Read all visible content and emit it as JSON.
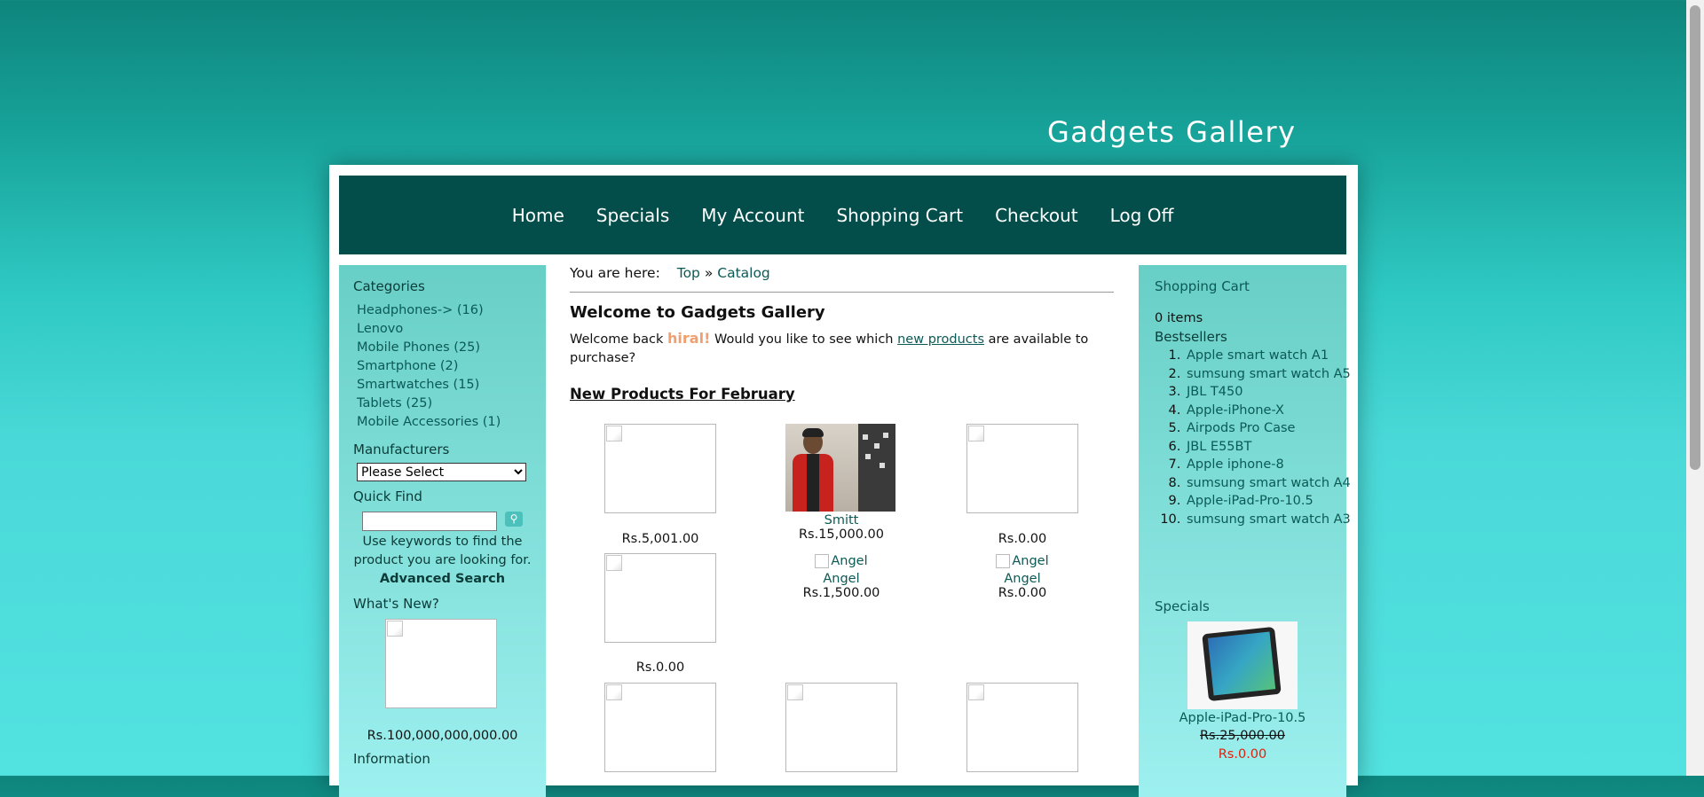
{
  "site": {
    "title": "Gadgets Gallery"
  },
  "nav": [
    "Home",
    "Specials",
    "My Account",
    "Shopping Cart",
    "Checkout",
    "Log Off"
  ],
  "left": {
    "categories_title": "Categories",
    "categories": [
      "Headphones-> (16)",
      "Lenovo",
      "Mobile Phones (25)",
      "Smartphone (2)",
      "Smartwatches (15)",
      "Tablets (25)",
      "Mobile Accessories (1)"
    ],
    "manufacturers_title": "Manufacturers",
    "manufacturers_selected": "Please Select",
    "quickfind_title": "Quick Find",
    "quickfind_help": "Use keywords to find the product you are looking for.",
    "advanced_search": "Advanced Search",
    "whatsnew_title": "What's New?",
    "whatsnew_price": "Rs.100,000,000,000.00",
    "information_title": "Information"
  },
  "center": {
    "breadcrumb_label": "You are here:",
    "breadcrumb_top": "Top",
    "breadcrumb_sep": "»",
    "breadcrumb_catalog": "Catalog",
    "heading": "Welcome to Gadgets Gallery",
    "greet_before": "Welcome back",
    "greet_user": "hiral!",
    "greet_mid": "Would you like to see which",
    "greet_link": "new products",
    "greet_after": "are available to purchase?",
    "new_products_title": "New Products For February",
    "products": [
      {
        "name": "",
        "price": "Rs.5,001.00"
      },
      {
        "name": "Smitt",
        "price": "Rs.15,000.00"
      },
      {
        "name": "",
        "price": "Rs.0.00"
      },
      {
        "name": "",
        "price": "Rs.0.00"
      },
      {
        "name": "Angel",
        "alt": "Angel",
        "price": "Rs.1,500.00"
      },
      {
        "name": "Angel",
        "alt": "Angel",
        "price": "Rs.0.00"
      }
    ]
  },
  "right": {
    "cart_title": "Shopping Cart",
    "cart_items": "0 items",
    "bestsellers_title": "Bestsellers",
    "bestsellers": [
      "Apple smart watch A1",
      "sumsung smart watch A5",
      "JBL T450",
      "Apple-iPhone-X",
      "Airpods Pro Case",
      "JBL E55BT",
      "Apple iphone-8",
      "sumsung smart watch A4",
      "Apple-iPad-Pro-10.5",
      "sumsung smart watch A3"
    ],
    "specials_title": "Specials",
    "special_name": "Apple-iPad-Pro-10.5",
    "special_old_price": "Rs.25,000.00",
    "special_new_price": "Rs.0.00"
  }
}
